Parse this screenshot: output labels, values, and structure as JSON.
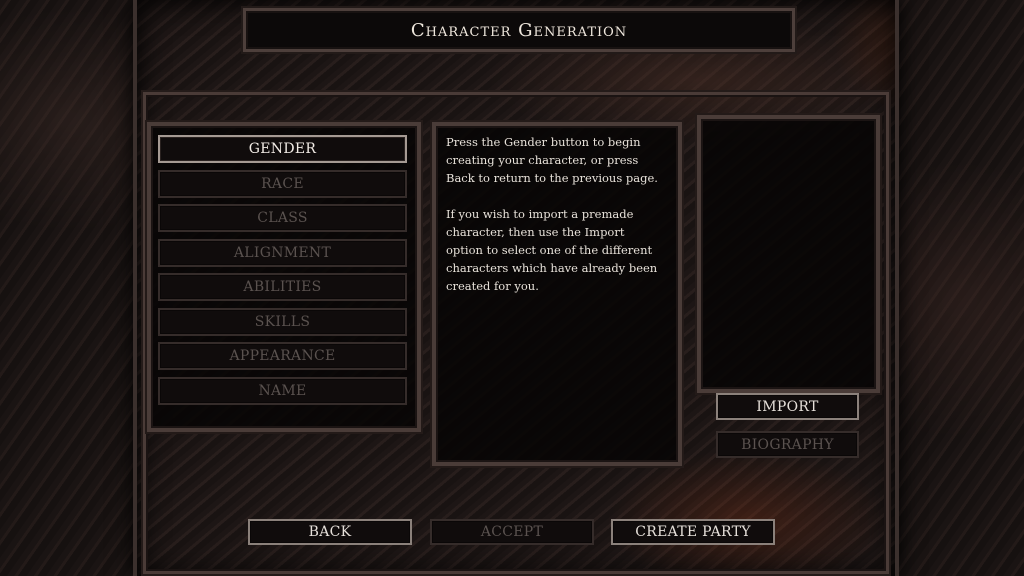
{
  "title": "Character Generation",
  "steps": [
    {
      "label": "GENDER",
      "state": "active"
    },
    {
      "label": "RACE",
      "state": "disabled"
    },
    {
      "label": "CLASS",
      "state": "disabled"
    },
    {
      "label": "ALIGNMENT",
      "state": "disabled"
    },
    {
      "label": "ABILITIES",
      "state": "disabled"
    },
    {
      "label": "SKILLS",
      "state": "disabled"
    },
    {
      "label": "APPEARANCE",
      "state": "disabled"
    },
    {
      "label": "NAME",
      "state": "disabled"
    }
  ],
  "description": {
    "paragraph1": "Press the Gender button to begin creating your character, or press Back to return to the previous page.",
    "paragraph2": "If you wish to import a premade character, then use the Import option to select one of the different characters which have already been created for you."
  },
  "side_buttons": {
    "import": "IMPORT",
    "biography": "BIOGRAPHY"
  },
  "bottom_buttons": {
    "back": "BACK",
    "accept": "ACCEPT",
    "create_party": "CREATE PARTY"
  },
  "colors": {
    "active_text": "#f2ece6",
    "disabled_text": "#5a524f",
    "frame": "#4a3c38",
    "background": "#140f0e"
  }
}
